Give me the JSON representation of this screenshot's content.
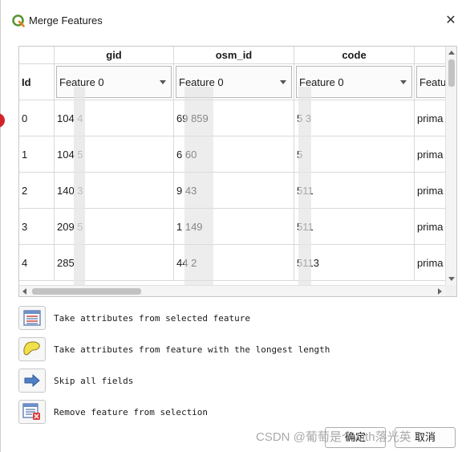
{
  "window": {
    "title": "Merge Features",
    "close_glyph": "✕",
    "app_icon": "qgis-logo"
  },
  "table": {
    "row_header_title": "Id",
    "columns": [
      {
        "name": "gid",
        "selector": "Feature 0"
      },
      {
        "name": "osm_id",
        "selector": "Feature 0"
      },
      {
        "name": "code",
        "selector": "Feature 0"
      },
      {
        "name": "",
        "selector": "Featu"
      }
    ],
    "rows": [
      {
        "id": "0",
        "cells": [
          "104  4",
          "69    859",
          "5  3",
          "prima"
        ]
      },
      {
        "id": "1",
        "cells": [
          "104  5",
          "6     60",
          "5",
          "prima"
        ]
      },
      {
        "id": "2",
        "cells": [
          "140  3",
          "9     43",
          "511",
          "prima"
        ]
      },
      {
        "id": "3",
        "cells": [
          "209  5",
          "1      149",
          "511",
          "prima"
        ]
      },
      {
        "id": "4",
        "cells": [
          "285",
          "44    2",
          "5113",
          "prima"
        ]
      }
    ]
  },
  "actions": [
    {
      "label": "Take attributes from selected feature",
      "icon": "attribute-table-icon"
    },
    {
      "label": "Take attributes from feature with the longest length",
      "icon": "longest-feature-icon"
    },
    {
      "label": "Skip all fields",
      "icon": "arrow-right-icon"
    },
    {
      "label": "Remove feature from selection",
      "icon": "remove-feature-icon"
    }
  ],
  "footer": {
    "ok_label": "确定",
    "cancel_label": "取消",
    "watermark": "CSDN @葡萄是个with落光英"
  },
  "colors": {
    "accent_red": "#d3232a",
    "qgis_green": "#589632",
    "qgis_yellow": "#ee7913"
  }
}
